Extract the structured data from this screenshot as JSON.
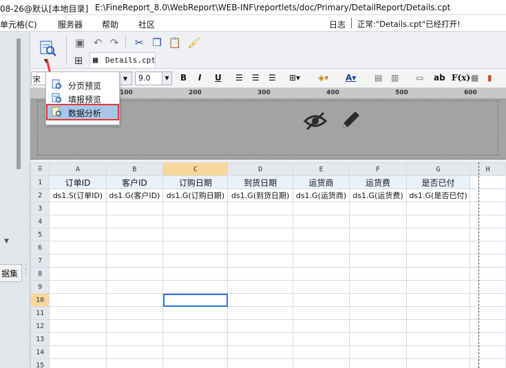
{
  "title_bar": {
    "prefix": "08-26@默认[本地目录]",
    "path": "E:\\FineReport_8.0\\WebReport\\WEB-INF\\reportlets/doc/Primary/DetailReport/Details.cpt"
  },
  "menu": {
    "items": [
      "单元格(C)",
      "服务器",
      "帮助",
      "社区"
    ],
    "log_label": "日志",
    "status": "正常:\"Details.cpt\"已经打开!"
  },
  "left_panel": {
    "dataset_tab_label": "据集"
  },
  "tabs": {
    "sheet_tab_label": "Details.cpt"
  },
  "format_bar": {
    "font_family_value": "宋",
    "font_size_value": "9.0",
    "bold": "B",
    "italic": "I",
    "underline": "U",
    "ab_label": "ab",
    "formula_label": "F(x)"
  },
  "ruler": {
    "ticks": [
      "100",
      "200",
      "300",
      "400",
      "500",
      "600"
    ]
  },
  "preview_menu": {
    "items": [
      "分页预览",
      "填报预览",
      "数据分析"
    ],
    "selected": "数据分析"
  },
  "grid": {
    "columns": [
      "A",
      "B",
      "C",
      "D",
      "E",
      "F",
      "G",
      "H"
    ],
    "selected_column": "C",
    "rows": [
      "1",
      "2",
      "3",
      "4",
      "5",
      "6",
      "7",
      "8",
      "9",
      "10",
      "11",
      "12",
      "13",
      "14",
      "15"
    ],
    "selected_row": "10",
    "header_row": [
      "订单ID",
      "客户ID",
      "订购日期",
      "到货日期",
      "运货商",
      "运货费",
      "是否已付"
    ],
    "data_row": [
      "ds1.S(订单ID)",
      "ds1.G(客户ID)",
      "ds1.G(订购日期)",
      "ds1.G(到货日期)",
      "ds1.G(运货商)",
      "ds1.G(运货费)",
      "ds1.G(是否已付)"
    ],
    "selected_cell": "C10"
  },
  "colors": {
    "selected_header": "#f8d79a",
    "selection_border": "#2f73d6",
    "menu_highlight": "#a9c6ea",
    "annotation_red": "#e53935"
  }
}
